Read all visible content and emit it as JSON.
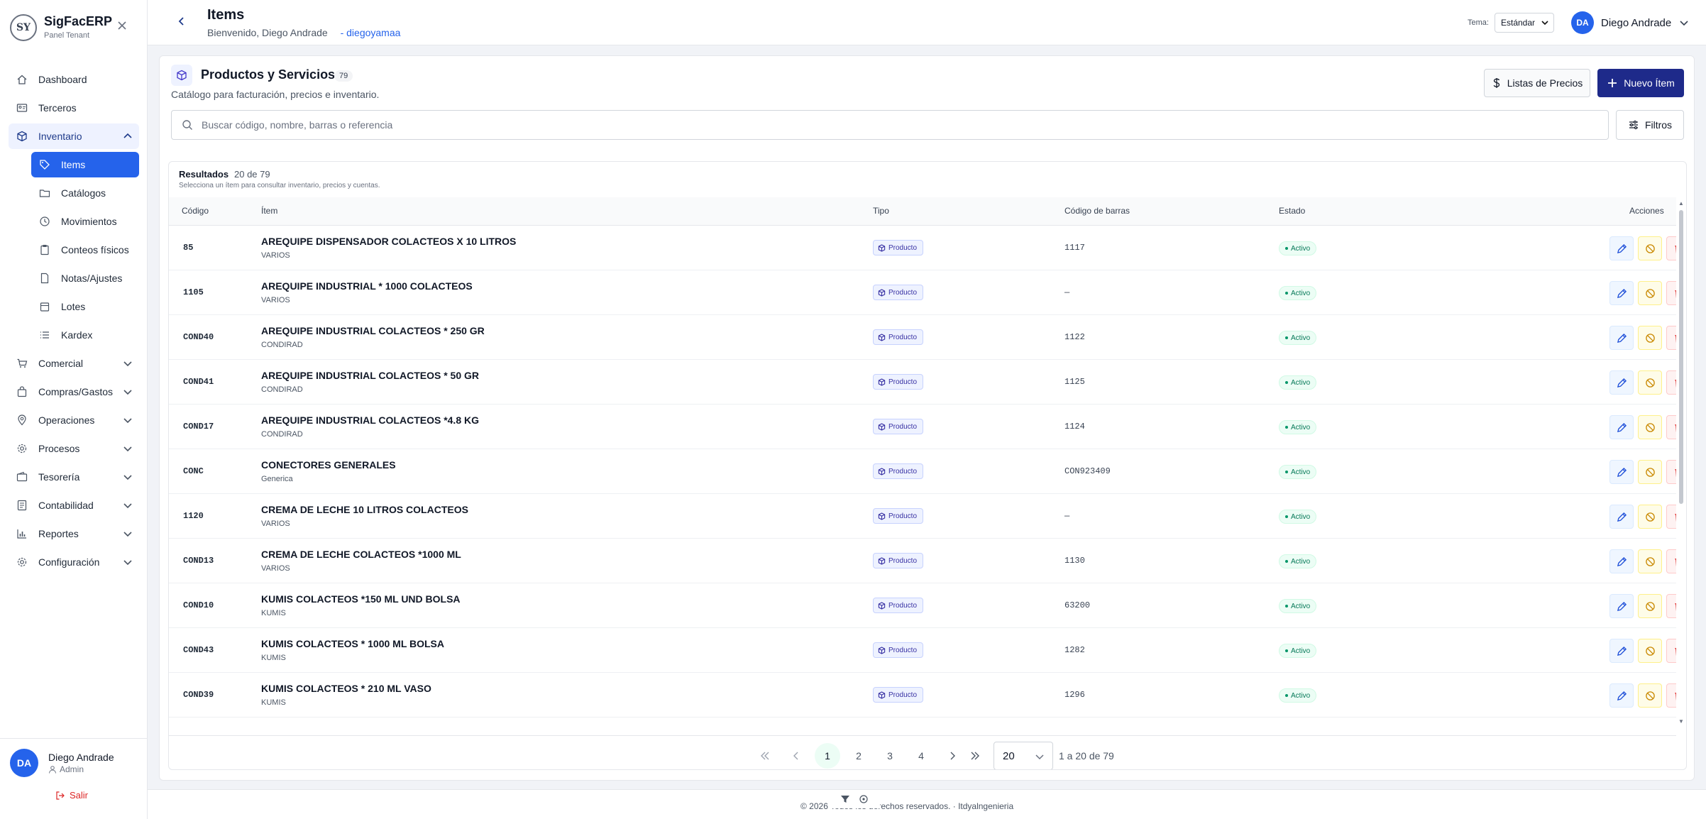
{
  "brand": {
    "name": "SigFacERP",
    "subtitle": "Panel Tenant",
    "logo_text": "SY"
  },
  "sidebar": {
    "items": [
      {
        "label": "Dashboard",
        "icon": "home-icon"
      },
      {
        "label": "Terceros",
        "icon": "id-card-icon"
      },
      {
        "label": "Inventario",
        "icon": "box-icon",
        "expanded": true,
        "children": [
          {
            "label": "Items",
            "icon": "tag-icon",
            "active": true
          },
          {
            "label": "Catálogos",
            "icon": "folder-icon"
          },
          {
            "label": "Movimientos",
            "icon": "clock-icon"
          },
          {
            "label": "Conteos físicos",
            "icon": "clipboard-icon"
          },
          {
            "label": "Notas/Ajustes",
            "icon": "file-icon"
          },
          {
            "label": "Lotes",
            "icon": "calendar-icon"
          },
          {
            "label": "Kardex",
            "icon": "list-icon"
          }
        ]
      },
      {
        "label": "Comercial",
        "icon": "cart-icon"
      },
      {
        "label": "Compras/Gastos",
        "icon": "bag-icon"
      },
      {
        "label": "Operaciones",
        "icon": "pin-icon"
      },
      {
        "label": "Procesos",
        "icon": "gear-icon"
      },
      {
        "label": "Tesorería",
        "icon": "wallet-icon"
      },
      {
        "label": "Contabilidad",
        "icon": "ledger-icon"
      },
      {
        "label": "Reportes",
        "icon": "bar-chart-icon"
      },
      {
        "label": "Configuración",
        "icon": "gear-icon"
      }
    ],
    "user": {
      "initials": "DA",
      "name": "Diego Andrade",
      "role": "Admin",
      "logout": "Salir"
    }
  },
  "header": {
    "title": "Items",
    "welcome": "Bienvenido, Diego Andrade",
    "tenant": "- diegoyamaa",
    "theme_label": "Tema:",
    "theme_value": "Estándar",
    "user_initials": "DA",
    "user_name": "Diego Andrade"
  },
  "section": {
    "title": "Productos y Servicios",
    "count": "79",
    "description": "Catálogo para facturación, precios e inventario.",
    "price_lists_label": "Listas de Precios",
    "new_item_label": "Nuevo Ítem",
    "search_placeholder": "Buscar código, nombre, barras o referencia",
    "filters_label": "Filtros"
  },
  "results": {
    "title": "Resultados",
    "range": "20 de 79",
    "subtitle": "Selecciona un ítem para consultar inventario, precios y cuentas.",
    "columns": [
      "Código",
      "Ítem",
      "Tipo",
      "Código de barras",
      "Estado",
      "Acciones"
    ],
    "rows": [
      {
        "code": "85",
        "name": "AREQUIPE DISPENSADOR COLACTEOS X 10 LITROS",
        "category": "VARIOS",
        "type": "Producto",
        "barcode": "1117",
        "status": "Activo"
      },
      {
        "code": "1105",
        "name": "AREQUIPE INDUSTRIAL * 1000 COLACTEOS",
        "category": "VARIOS",
        "type": "Producto",
        "barcode": "—",
        "status": "Activo"
      },
      {
        "code": "COND40",
        "name": "AREQUIPE INDUSTRIAL COLACTEOS * 250 GR",
        "category": "CONDIRAD",
        "type": "Producto",
        "barcode": "1122",
        "status": "Activo"
      },
      {
        "code": "COND41",
        "name": "AREQUIPE INDUSTRIAL COLACTEOS * 50 GR",
        "category": "CONDIRAD",
        "type": "Producto",
        "barcode": "1125",
        "status": "Activo"
      },
      {
        "code": "COND17",
        "name": "AREQUIPE INDUSTRIAL COLACTEOS *4.8 KG",
        "category": "CONDIRAD",
        "type": "Producto",
        "barcode": "1124",
        "status": "Activo"
      },
      {
        "code": "CONC",
        "name": "CONECTORES GENERALES",
        "category": "Generica",
        "type": "Producto",
        "barcode": "CON923409",
        "status": "Activo"
      },
      {
        "code": "1120",
        "name": "CREMA DE LECHE 10 LITROS COLACTEOS",
        "category": "VARIOS",
        "type": "Producto",
        "barcode": "—",
        "status": "Activo"
      },
      {
        "code": "COND13",
        "name": "CREMA DE LECHE COLACTEOS *1000 ML",
        "category": "VARIOS",
        "type": "Producto",
        "barcode": "1130",
        "status": "Activo"
      },
      {
        "code": "COND10",
        "name": "KUMIS COLACTEOS *150 ML UND BOLSA",
        "category": "KUMIS",
        "type": "Producto",
        "barcode": "63200",
        "status": "Activo"
      },
      {
        "code": "COND43",
        "name": "KUMIS COLACTEOS * 1000 ML BOLSA",
        "category": "KUMIS",
        "type": "Producto",
        "barcode": "1282",
        "status": "Activo"
      },
      {
        "code": "COND39",
        "name": "KUMIS COLACTEOS * 210 ML VASO",
        "category": "KUMIS",
        "type": "Producto",
        "barcode": "1296",
        "status": "Activo"
      }
    ]
  },
  "pagination": {
    "pages": [
      "1",
      "2",
      "3",
      "4"
    ],
    "current": "1",
    "page_size": "20",
    "info": "1 a 20 de 79"
  },
  "footer": {
    "text": "© 2026 Todos los derechos reservados. · Itdyalngenieria"
  },
  "colors": {
    "primary": "#1e2a8a",
    "accent": "#2563eb",
    "success": "#047857"
  }
}
